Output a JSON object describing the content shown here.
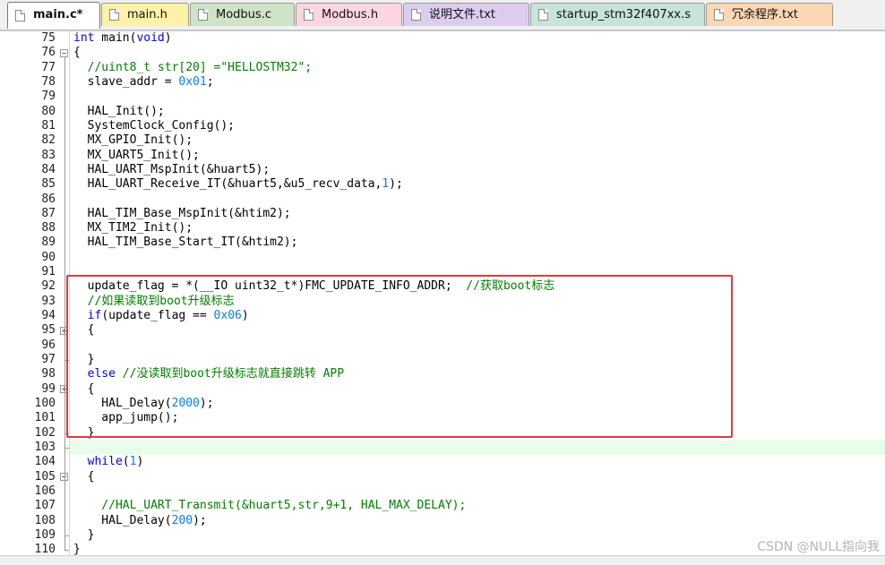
{
  "tabs": [
    {
      "label": "main.c*",
      "color": "#ffffff",
      "active": true
    },
    {
      "label": "main.h",
      "color": "#fff2a8",
      "active": false
    },
    {
      "label": "Modbus.c",
      "color": "#cfe3c6",
      "active": false
    },
    {
      "label": "Modbus.h",
      "color": "#fbd5df",
      "active": false
    },
    {
      "label": "说明文件.txt",
      "color": "#dccdf0",
      "active": false
    },
    {
      "label": "startup_stm32f407xx.s",
      "color": "#c6e4da",
      "active": false
    },
    {
      "label": "冗余程序.txt",
      "color": "#fbd7b4",
      "active": false
    }
  ],
  "editor": {
    "highlighted_line": 103,
    "lines": [
      {
        "n": "75",
        "fold": "",
        "tokens": [
          {
            "t": "int",
            "c": "kw"
          },
          {
            "t": " main(",
            "c": ""
          },
          {
            "t": "void",
            "c": "kw"
          },
          {
            "t": ")",
            "c": ""
          }
        ]
      },
      {
        "n": "76",
        "fold": "open",
        "tokens": [
          {
            "t": "{",
            "c": ""
          }
        ]
      },
      {
        "n": "77",
        "fold": "",
        "tokens": [
          {
            "t": "  //uint8_t str[20] =\"HELLOSTM32\";",
            "c": "cm"
          }
        ]
      },
      {
        "n": "78",
        "fold": "",
        "tokens": [
          {
            "t": "  slave_addr = ",
            "c": ""
          },
          {
            "t": "0x01",
            "c": "num"
          },
          {
            "t": ";",
            "c": ""
          }
        ]
      },
      {
        "n": "79",
        "fold": "",
        "tokens": []
      },
      {
        "n": "80",
        "fold": "",
        "tokens": [
          {
            "t": "  HAL_Init();",
            "c": ""
          }
        ]
      },
      {
        "n": "81",
        "fold": "",
        "tokens": [
          {
            "t": "  SystemClock_Config();",
            "c": ""
          }
        ]
      },
      {
        "n": "82",
        "fold": "",
        "tokens": [
          {
            "t": "  MX_GPIO_Init();",
            "c": ""
          }
        ]
      },
      {
        "n": "83",
        "fold": "",
        "tokens": [
          {
            "t": "  MX_UART5_Init();",
            "c": ""
          }
        ]
      },
      {
        "n": "84",
        "fold": "",
        "tokens": [
          {
            "t": "  HAL_UART_MspInit(&huart5);",
            "c": ""
          }
        ]
      },
      {
        "n": "85",
        "fold": "",
        "tokens": [
          {
            "t": "  HAL_UART_Receive_IT(&huart5,&u5_recv_data,",
            "c": ""
          },
          {
            "t": "1",
            "c": "num"
          },
          {
            "t": ");",
            "c": ""
          }
        ]
      },
      {
        "n": "86",
        "fold": "",
        "tokens": []
      },
      {
        "n": "87",
        "fold": "",
        "tokens": [
          {
            "t": "  HAL_TIM_Base_MspInit(&htim2);",
            "c": ""
          }
        ]
      },
      {
        "n": "88",
        "fold": "",
        "tokens": [
          {
            "t": "  MX_TIM2_Init();",
            "c": ""
          }
        ]
      },
      {
        "n": "89",
        "fold": "",
        "tokens": [
          {
            "t": "  HAL_TIM_Base_Start_IT(&htim2);",
            "c": ""
          }
        ]
      },
      {
        "n": "90",
        "fold": "",
        "tokens": []
      },
      {
        "n": "91",
        "fold": "",
        "tokens": []
      },
      {
        "n": "92",
        "fold": "",
        "tokens": [
          {
            "t": "  update_flag = *(__IO uint32_t*)FMC_UPDATE_INFO_ADDR;  ",
            "c": ""
          },
          {
            "t": "//获取boot标志",
            "c": "cm"
          }
        ]
      },
      {
        "n": "93",
        "fold": "",
        "tokens": [
          {
            "t": "  //如果读取到boot升级标志",
            "c": "cm"
          }
        ]
      },
      {
        "n": "94",
        "fold": "",
        "tokens": [
          {
            "t": "  ",
            "c": ""
          },
          {
            "t": "if",
            "c": "kw"
          },
          {
            "t": "(update_flag == ",
            "c": ""
          },
          {
            "t": "0x06",
            "c": "num"
          },
          {
            "t": ")",
            "c": ""
          }
        ]
      },
      {
        "n": "95",
        "fold": "closed",
        "tokens": [
          {
            "t": "  {",
            "c": ""
          }
        ]
      },
      {
        "n": "96",
        "fold": "",
        "tokens": []
      },
      {
        "n": "97",
        "fold": "end",
        "tokens": [
          {
            "t": "  }",
            "c": ""
          }
        ]
      },
      {
        "n": "98",
        "fold": "",
        "tokens": [
          {
            "t": "  ",
            "c": ""
          },
          {
            "t": "else",
            "c": "kw"
          },
          {
            "t": " ",
            "c": ""
          },
          {
            "t": "//没读取到boot升级标志就直接跳转 APP",
            "c": "cm"
          }
        ]
      },
      {
        "n": "99",
        "fold": "closed",
        "tokens": [
          {
            "t": "  {",
            "c": ""
          }
        ]
      },
      {
        "n": "100",
        "fold": "",
        "tokens": [
          {
            "t": "    HAL_Delay(",
            "c": ""
          },
          {
            "t": "2000",
            "c": "num"
          },
          {
            "t": ");",
            "c": ""
          }
        ]
      },
      {
        "n": "101",
        "fold": "",
        "tokens": [
          {
            "t": "    app_jump();",
            "c": ""
          }
        ]
      },
      {
        "n": "102",
        "fold": "end",
        "tokens": [
          {
            "t": "  }",
            "c": ""
          }
        ]
      },
      {
        "n": "103",
        "fold": "end",
        "tokens": []
      },
      {
        "n": "104",
        "fold": "",
        "tokens": [
          {
            "t": "  ",
            "c": ""
          },
          {
            "t": "while",
            "c": "kw"
          },
          {
            "t": "(",
            "c": ""
          },
          {
            "t": "1",
            "c": "num"
          },
          {
            "t": ")",
            "c": ""
          }
        ]
      },
      {
        "n": "105",
        "fold": "open",
        "tokens": [
          {
            "t": "  {",
            "c": ""
          }
        ]
      },
      {
        "n": "106",
        "fold": "",
        "tokens": []
      },
      {
        "n": "107",
        "fold": "",
        "tokens": [
          {
            "t": "    //HAL_UART_Transmit(&huart5,str,9+1, HAL_MAX_DELAY);",
            "c": "cm"
          }
        ]
      },
      {
        "n": "108",
        "fold": "",
        "tokens": [
          {
            "t": "    HAL_Delay(",
            "c": ""
          },
          {
            "t": "200",
            "c": "num"
          },
          {
            "t": ");",
            "c": ""
          }
        ]
      },
      {
        "n": "109",
        "fold": "end",
        "tokens": [
          {
            "t": "  }",
            "c": ""
          }
        ]
      },
      {
        "n": "110",
        "fold": "end",
        "tokens": [
          {
            "t": "}",
            "c": ""
          }
        ]
      }
    ]
  },
  "watermark": "CSDN @NULL指向我",
  "colors": {
    "keyword": "#0000ff",
    "number": "#0080ff",
    "comment": "#008000",
    "current_line": "#e8fde8",
    "annotation_box": "#e03c3c"
  }
}
